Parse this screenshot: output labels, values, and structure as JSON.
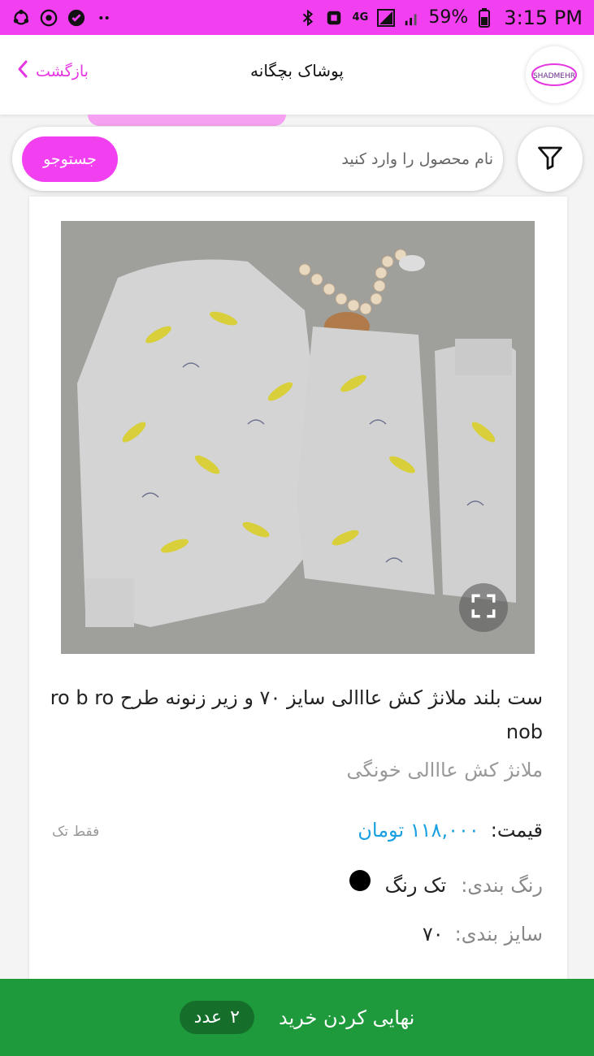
{
  "status_bar": {
    "battery": "59%",
    "time": "3:15 PM",
    "network": "4G"
  },
  "header": {
    "back_label": "بازگشت",
    "title": "پوشاک بچگانه",
    "logo_text": "SHADMEHR"
  },
  "search": {
    "button_label": "جستوجو",
    "placeholder": "نام محصول را وارد کنید"
  },
  "product": {
    "title": "ست بلند ملانژ کش عااالی سایز ۷۰ و زیر زنونه طرح ro b ro nob",
    "subtitle": "ملانژ کش عااالی خونگی",
    "price_label": "قیمت:",
    "price_value": "۱۱۸,۰۰۰ تومان",
    "single_note": "فقط تک",
    "color_label": "رنگ بندی:",
    "color_value": "تک رنگ",
    "color_hex": "#000000",
    "size_label": "سایز بندی:",
    "size_value": "۷۰"
  },
  "checkout": {
    "label": "نهایی کردن خرید",
    "count": "۲",
    "count_unit": "عدد"
  },
  "colors": {
    "accent": "#f23ff0",
    "price": "#1aa0e0",
    "checkout": "#1e9a3c"
  }
}
